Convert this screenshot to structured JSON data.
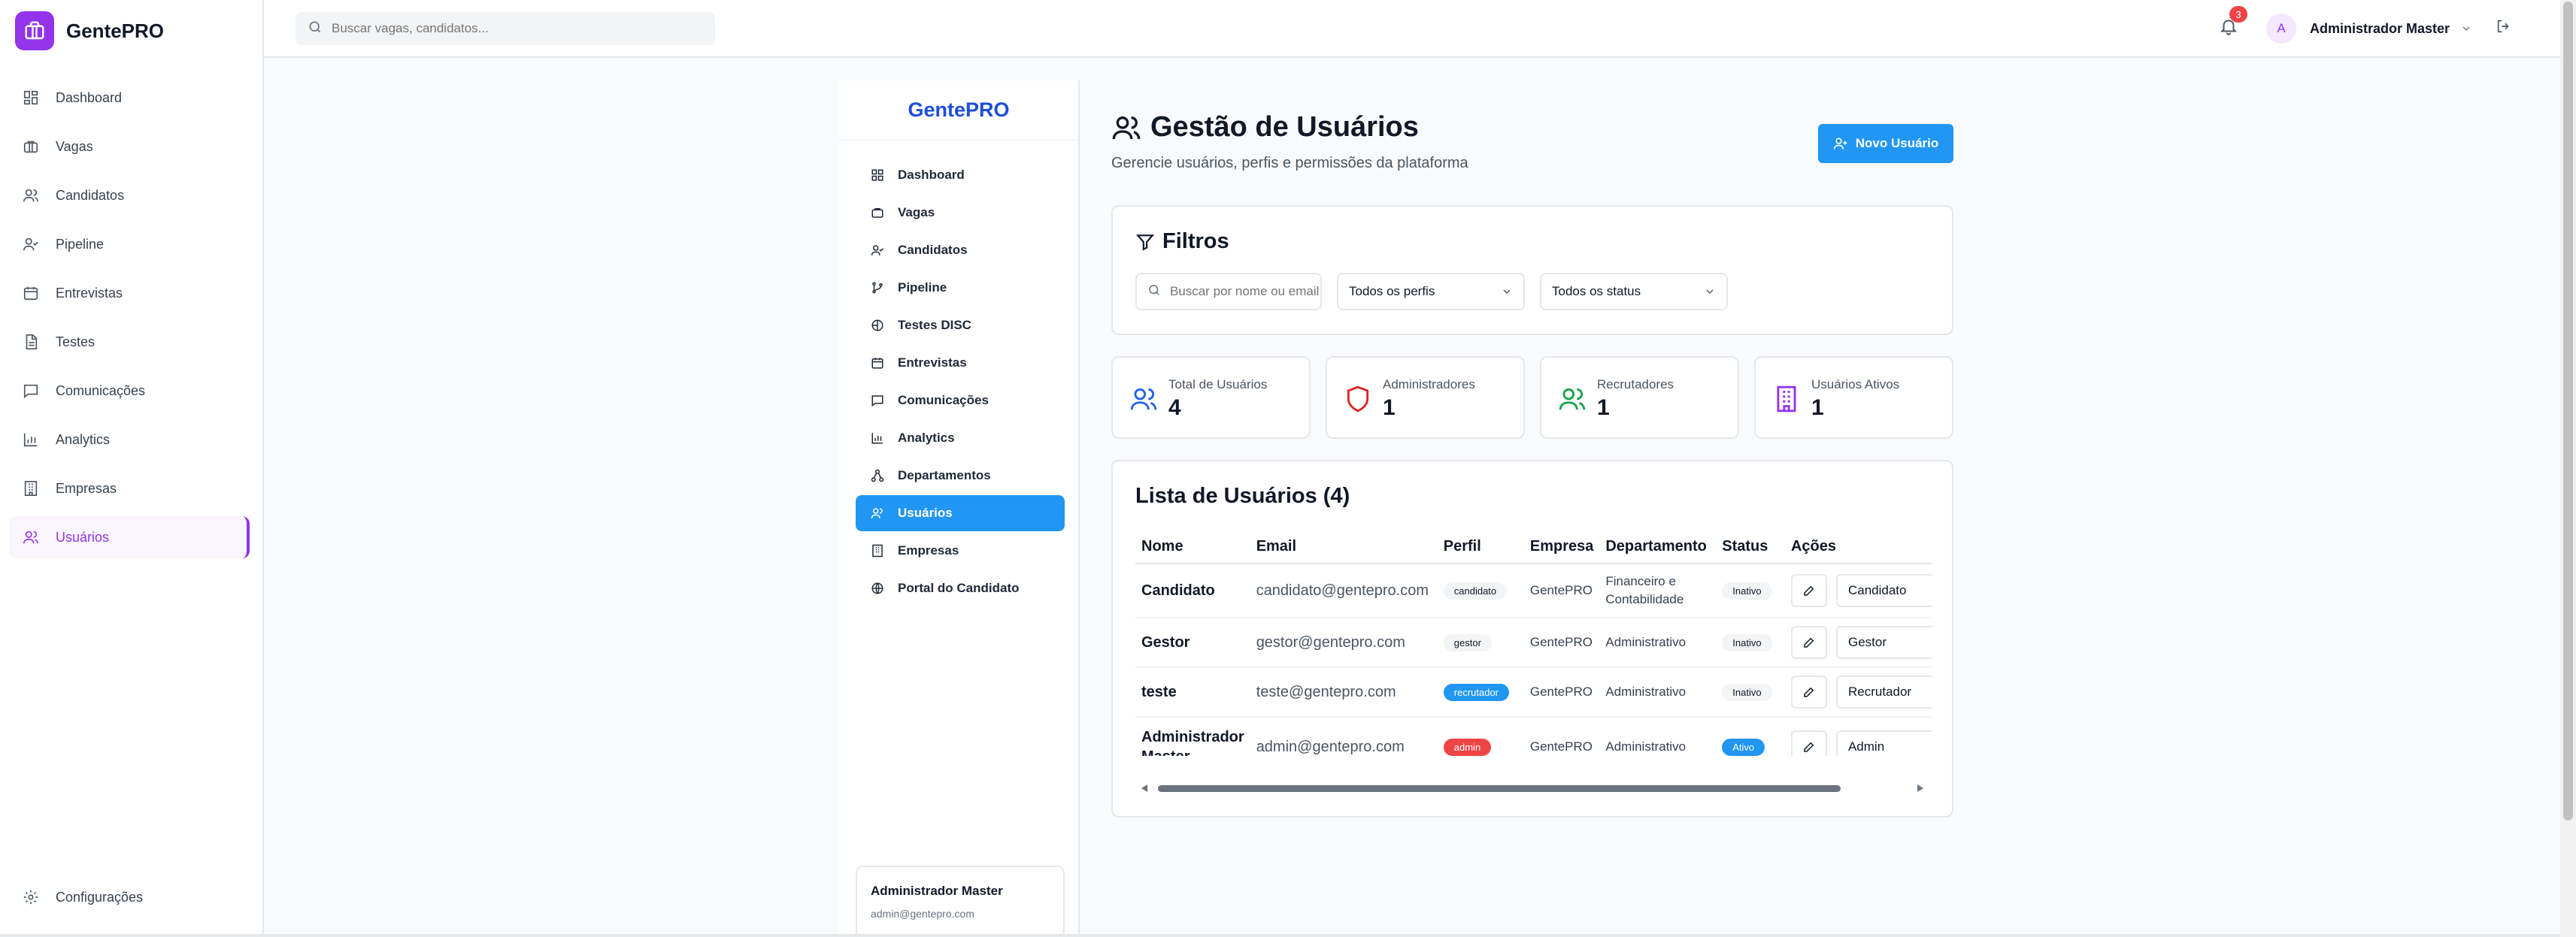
{
  "app": {
    "name": "GentePRO"
  },
  "header": {
    "search_placeholder": "Buscar vagas, candidatos...",
    "notification_count": "3",
    "avatar_initial": "A",
    "user_name": "Administrador Master"
  },
  "sidebar": {
    "items": [
      {
        "label": "Dashboard",
        "icon": "dashboard-icon"
      },
      {
        "label": "Vagas",
        "icon": "briefcase-icon"
      },
      {
        "label": "Candidatos",
        "icon": "users-icon"
      },
      {
        "label": "Pipeline",
        "icon": "user-check-icon"
      },
      {
        "label": "Entrevistas",
        "icon": "calendar-icon"
      },
      {
        "label": "Testes",
        "icon": "file-text-icon"
      },
      {
        "label": "Comunicações",
        "icon": "message-icon"
      },
      {
        "label": "Analytics",
        "icon": "bar-chart-icon"
      },
      {
        "label": "Empresas",
        "icon": "building-icon"
      },
      {
        "label": "Usuários",
        "icon": "users-icon"
      }
    ],
    "active": "Usuários",
    "settings_label": "Configurações"
  },
  "inner_sidebar": {
    "brand": "GentePRO",
    "items": [
      {
        "label": "Dashboard"
      },
      {
        "label": "Vagas"
      },
      {
        "label": "Candidatos"
      },
      {
        "label": "Pipeline"
      },
      {
        "label": "Testes DISC"
      },
      {
        "label": "Entrevistas"
      },
      {
        "label": "Comunicações"
      },
      {
        "label": "Analytics"
      },
      {
        "label": "Departamentos"
      },
      {
        "label": "Usuários"
      },
      {
        "label": "Empresas"
      },
      {
        "label": "Portal do Candidato"
      }
    ],
    "user": {
      "name": "Administrador Master",
      "email": "admin@gentepro.com"
    }
  },
  "page": {
    "title": "Gestão de Usuários",
    "subtitle": "Gerencie usuários, perfis e permissões da plataforma",
    "new_user_label": "Novo Usuário"
  },
  "filters": {
    "title": "Filtros",
    "search_placeholder": "Buscar por nome ou email...",
    "profile_value": "Todos os perfis",
    "status_value": "Todos os status"
  },
  "stats": [
    {
      "label": "Total de Usuários",
      "value": "4",
      "color": "#2563eb"
    },
    {
      "label": "Administradores",
      "value": "1",
      "color": "#dc2626"
    },
    {
      "label": "Recrutadores",
      "value": "1",
      "color": "#16a34a"
    },
    {
      "label": "Usuários Ativos",
      "value": "1",
      "color": "#9333ea"
    }
  ],
  "user_list": {
    "title": "Lista de Usuários (4)",
    "columns": [
      "Nome",
      "Email",
      "Perfil",
      "Empresa",
      "Departamento",
      "Status",
      "Ações"
    ],
    "rows": [
      {
        "name": "Candidato",
        "email": "candidato@gentepro.com",
        "profile": "candidato",
        "company": "GentePRO",
        "department": "Financeiro e Contabilidade",
        "status": "Inativo",
        "role": "Candidato"
      },
      {
        "name": "Gestor",
        "email": "gestor@gentepro.com",
        "profile": "gestor",
        "company": "GentePRO",
        "department": "Administrativo",
        "status": "Inativo",
        "role": "Gestor"
      },
      {
        "name": "teste",
        "email": "teste@gentepro.com",
        "profile": "recrutador",
        "company": "GentePRO",
        "department": "Administrativo",
        "status": "Inativo",
        "role": "Recrutador"
      },
      {
        "name": "Administrador Master",
        "email": "admin@gentepro.com",
        "profile": "admin",
        "company": "GentePRO",
        "department": "Administrativo",
        "status": "Ativo",
        "role": "Admin"
      }
    ]
  },
  "colors": {
    "brand_purple": "#9333ea",
    "primary_blue": "#2196f3",
    "danger_red": "#ef4444"
  }
}
